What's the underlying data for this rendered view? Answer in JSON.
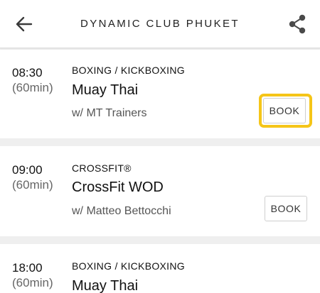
{
  "header": {
    "title": "DYNAMIC CLUB PHUKET"
  },
  "classes": [
    {
      "time": "08:30",
      "duration": "(60min)",
      "category": "BOXING / KICKBOXING",
      "name": "Muay Thai",
      "instructor": "w/ MT Trainers",
      "book_label": "BOOK",
      "highlighted": true
    },
    {
      "time": "09:00",
      "duration": "(60min)",
      "category": "CROSSFIT®",
      "name": "CrossFit WOD",
      "instructor": "w/ Matteo Bettocchi",
      "book_label": "BOOK",
      "highlighted": false
    },
    {
      "time": "18:00",
      "duration": "(60min)",
      "category": "BOXING / KICKBOXING",
      "name": "Muay Thai",
      "instructor": "",
      "book_label": "",
      "highlighted": false
    }
  ],
  "colors": {
    "highlight": "#f5c518",
    "background": "#efefef",
    "card": "#ffffff"
  },
  "icons": {
    "back": "arrow-left-icon",
    "share": "share-icon"
  }
}
